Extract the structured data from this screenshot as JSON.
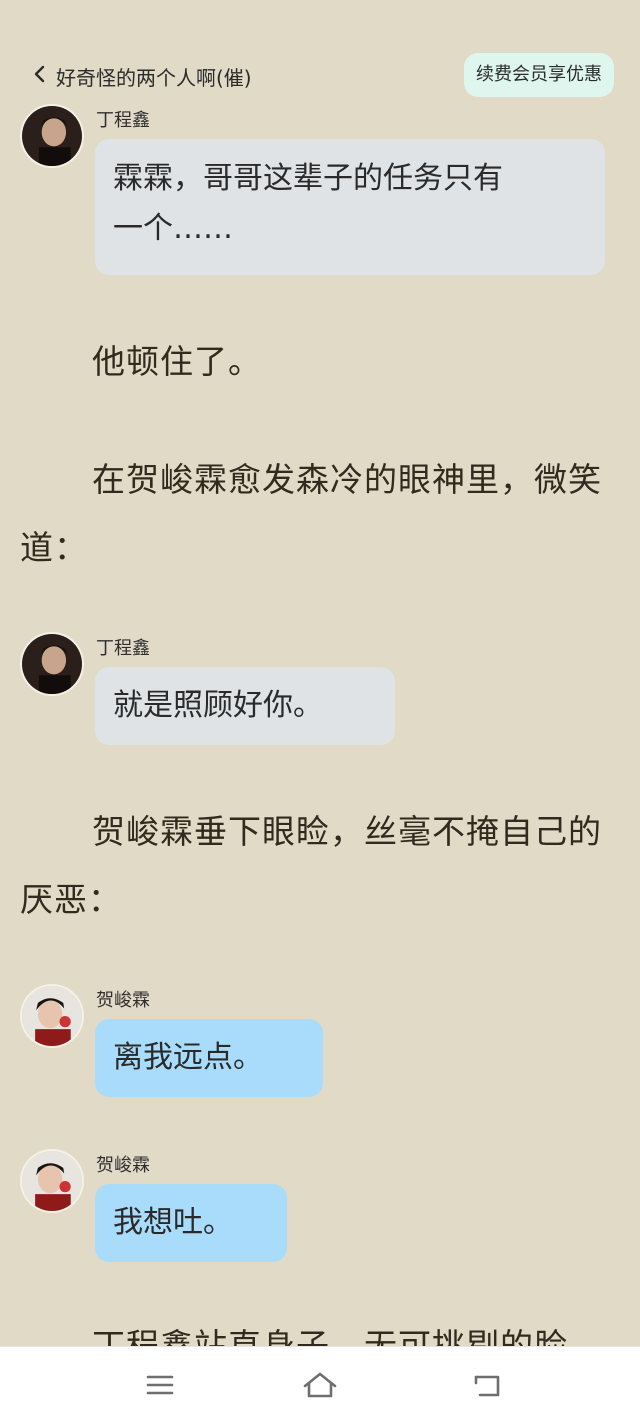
{
  "header": {
    "back_title": "好奇怪的两个人啊(催)",
    "vip_label": "续费会员享优惠"
  },
  "messages": [
    {
      "speaker": "丁程鑫",
      "text_line1": "霖霖，哥哥这辈子的任务只有",
      "text_line2": "一个……"
    },
    {
      "speaker": "丁程鑫",
      "text": "就是照顾好你。"
    },
    {
      "speaker": "贺峻霖",
      "text": "离我远点。"
    },
    {
      "speaker": "贺峻霖",
      "text": "我想吐。"
    }
  ],
  "paragraphs": [
    "他顿住了。",
    "在贺峻霖愈发森冷的眼神里，微笑道：",
    "贺峻霖垂下眼睑，丝毫不掩自己的厌恶：",
    "丁程鑫站直身子，无可挑剔的脸"
  ],
  "colors": {
    "background": "#e0dac6",
    "bubble_gray": "#dfe3e6",
    "bubble_blue": "#a9dcfa",
    "vip_bg": "#dff6ef"
  },
  "icons": {
    "back": "chevron-left-icon",
    "menu": "menu-icon",
    "home": "home-icon",
    "return": "back-icon"
  }
}
